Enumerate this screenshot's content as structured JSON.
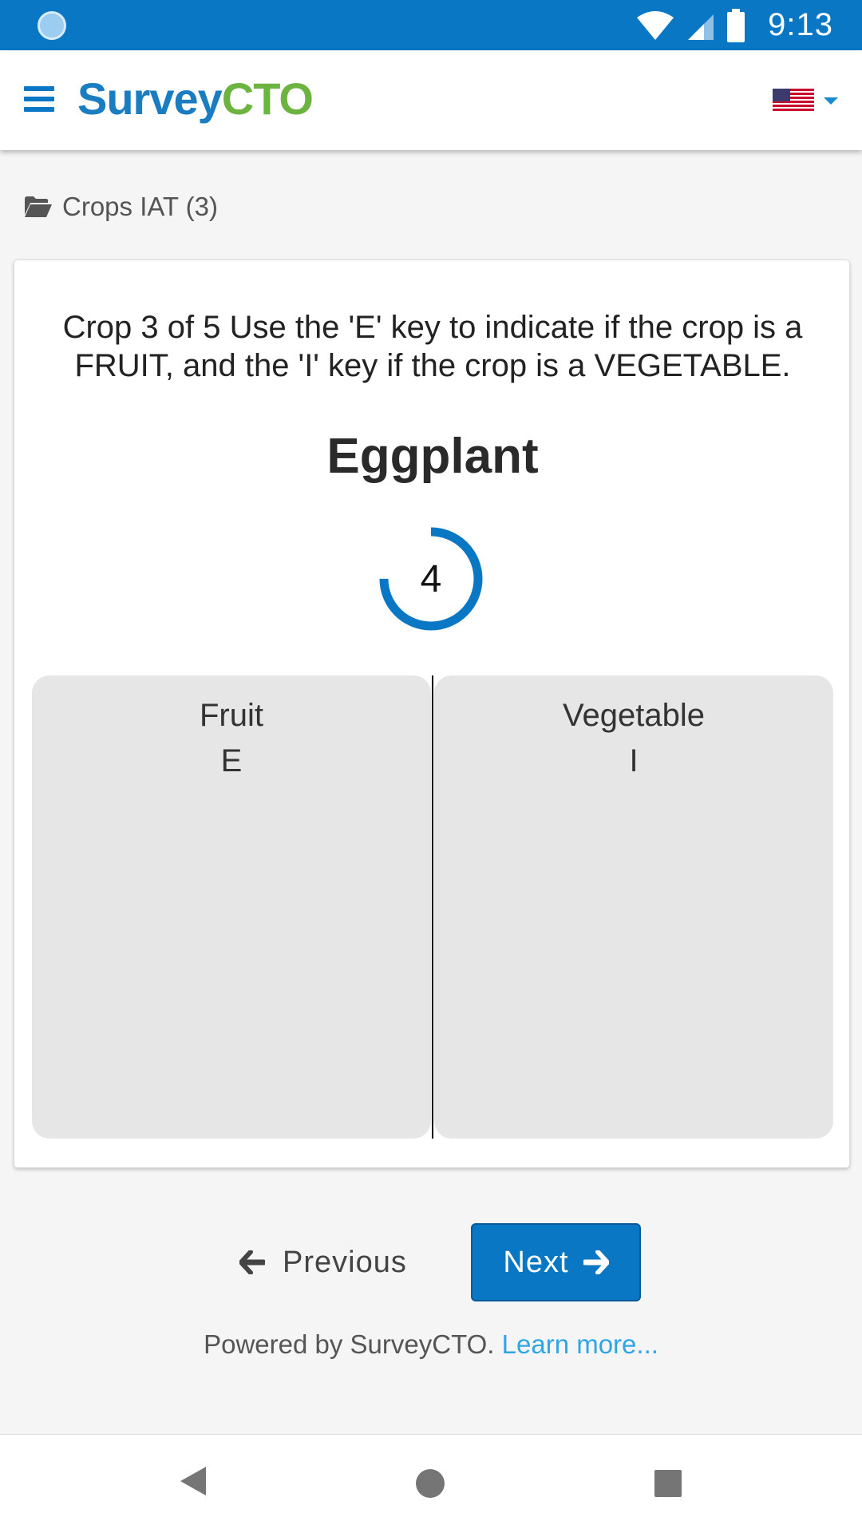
{
  "status_bar": {
    "time": "9:13",
    "icons": [
      "circle-notification-icon",
      "wifi-icon",
      "signal-icon",
      "battery-icon"
    ]
  },
  "header": {
    "logo_part1": "Survey",
    "logo_part2": "CTO",
    "menu_icon": "hamburger-menu-icon",
    "language_icon": "us-flag-icon",
    "colors": {
      "brand_blue": "#1a7cc1",
      "brand_green": "#6db33f"
    }
  },
  "breadcrumb": {
    "icon": "folder-open-icon",
    "label": "Crops IAT (3)"
  },
  "question": {
    "instructions": "Crop 3 of 5 Use the 'E' key to indicate if the crop is a FRUIT, and the 'I' key if the crop is a VEGETABLE.",
    "crop": "Eggplant",
    "timer_value": "4",
    "timer_progress": 0.75
  },
  "choices": [
    {
      "label": "Fruit",
      "key": "E"
    },
    {
      "label": "Vegetable",
      "key": "I"
    }
  ],
  "navigation": {
    "previous_label": "Previous",
    "next_label": "Next",
    "accent_color": "#0a77c4"
  },
  "footer": {
    "powered_text": "Powered by SurveyCTO.",
    "learn_more": "Learn more..."
  }
}
